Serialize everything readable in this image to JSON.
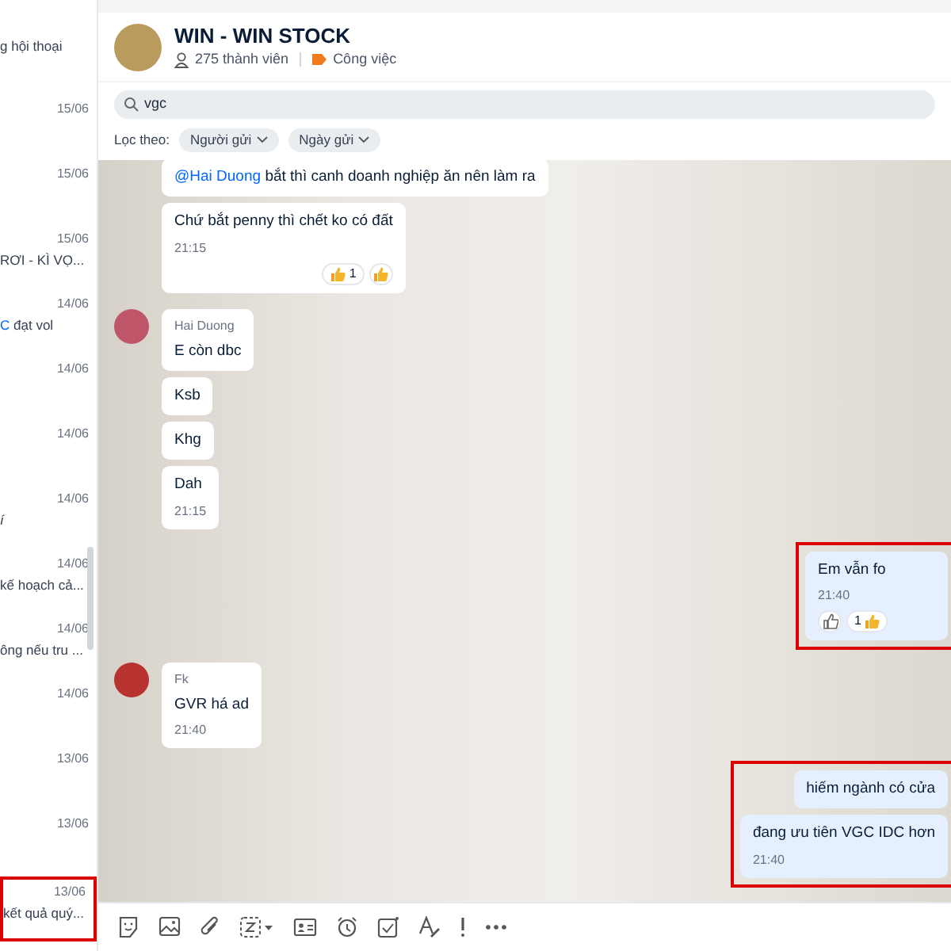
{
  "sidebar": {
    "items": [
      {
        "preview": "g hội thoại",
        "highlighted": false
      },
      {
        "date": "15/06",
        "highlighted": false
      },
      {
        "date": "15/06",
        "highlighted": false
      },
      {
        "date": "15/06",
        "preview": "RƠI - KÌ VỌ...",
        "highlighted": false
      },
      {
        "date": "14/06",
        "preview_mention": "C",
        "preview": "đạt vol",
        "highlighted": false
      },
      {
        "date": "14/06",
        "highlighted": false
      },
      {
        "date": "14/06",
        "highlighted": false
      },
      {
        "date": "14/06",
        "preview": "í",
        "italic": true,
        "highlighted": false
      },
      {
        "date": "14/06",
        "preview": "kế hoạch cả...",
        "highlighted": false
      },
      {
        "date": "14/06",
        "preview": "ông nếu tru ...",
        "highlighted": false
      },
      {
        "date": "14/06",
        "highlighted": false
      },
      {
        "date": "13/06",
        "highlighted": false
      },
      {
        "date": "13/06",
        "highlighted": false
      },
      {
        "date": "13/06",
        "preview": "kết quả quý...",
        "highlighted": true
      }
    ]
  },
  "header": {
    "title": "WIN - WIN STOCK",
    "members": "275 thành viên",
    "tag": "Công việc"
  },
  "search": {
    "value": "vgc"
  },
  "filter": {
    "label": "Lọc theo:",
    "chips": [
      "Người gửi",
      "Ngày gửi"
    ]
  },
  "messages": [
    {
      "kind": "incoming",
      "highlighted": false,
      "bubbles": [
        {
          "mention": "@Hai Duong",
          "text": "bắt thì canh doanh nghiệp ăn nên làm ra"
        },
        {
          "text": "Chứ bắt penny thì chết ko có đất",
          "time": "21:15",
          "reactions": [
            {
              "kind": "count",
              "count": "1"
            },
            {
              "kind": "quick",
              "filled": true
            }
          ]
        }
      ]
    },
    {
      "kind": "incoming",
      "sender": "Hai Duong",
      "highlighted": false,
      "bubbles": [
        {
          "text": "E còn dbc"
        },
        {
          "text": "Ksb"
        },
        {
          "text": "Khg"
        },
        {
          "text": "Dah",
          "time": "21:15"
        }
      ]
    },
    {
      "kind": "outgoing",
      "highlighted": true,
      "bubbles": [
        {
          "text": "Em vẫn fo",
          "time": "21:40",
          "reactions": [
            {
              "kind": "quick",
              "filled": false
            },
            {
              "kind": "count",
              "count": "1"
            }
          ]
        }
      ]
    },
    {
      "kind": "incoming",
      "sender": "Fk",
      "highlighted": false,
      "bubbles": [
        {
          "text": "GVR há ad",
          "time": "21:40"
        }
      ]
    },
    {
      "kind": "outgoing",
      "highlighted": true,
      "bubbles": [
        {
          "text": "hiếm ngành có cửa"
        },
        {
          "text": "đang ưu tiên VGC IDC  hơn",
          "time": "21:40"
        }
      ]
    }
  ],
  "toolbar": [
    {
      "kind": "sticker"
    },
    {
      "kind": "image"
    },
    {
      "kind": "attach"
    },
    {
      "kind": "screenshot"
    },
    {
      "kind": "contact"
    },
    {
      "kind": "reminder"
    },
    {
      "kind": "task"
    },
    {
      "kind": "format"
    },
    {
      "kind": "urgent"
    },
    {
      "kind": "more"
    }
  ]
}
